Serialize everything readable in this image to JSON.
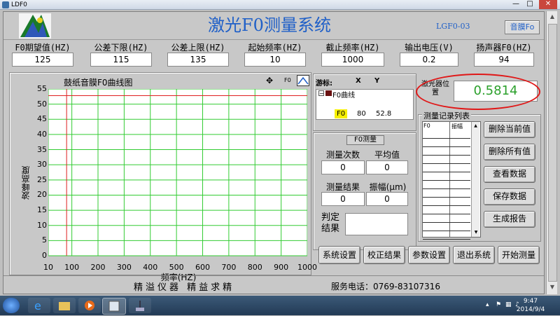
{
  "window": {
    "title": "LDF0"
  },
  "header": {
    "title": "激光F0测量系统",
    "model": "LGF0-03",
    "mode_button": "音膜Fo"
  },
  "params": [
    {
      "label": "F0期望值(HZ)",
      "value": "125"
    },
    {
      "label": "公差下限(HZ)",
      "value": "115"
    },
    {
      "label": "公差上限(HZ)",
      "value": "135"
    },
    {
      "label": "起始频率(HZ)",
      "value": "10"
    },
    {
      "label": "截止频率(HZ)",
      "value": "1000"
    },
    {
      "label": "输出电压(V)",
      "value": "0.2"
    },
    {
      "label": "扬声器F0(HZ)",
      "value": "94"
    }
  ],
  "chart": {
    "legend_label": "F0"
  },
  "chart_data": {
    "type": "line",
    "title": "鼓纸音膜F0曲线图",
    "xlabel": "频率(HZ)",
    "ylabel": "波峰高度",
    "xlim": [
      10,
      1000
    ],
    "ylim": [
      0,
      55
    ],
    "x_ticks": [
      "10",
      "100",
      "200",
      "300",
      "400",
      "500",
      "600",
      "700",
      "800",
      "900",
      "1000"
    ],
    "y_ticks": [
      "0",
      "5",
      "10",
      "15",
      "20",
      "25",
      "30",
      "35",
      "40",
      "45",
      "50",
      "55"
    ],
    "grid": true,
    "cursor": {
      "x": 80,
      "y": 52.8
    },
    "series": []
  },
  "cursor_panel": {
    "title": "游标:",
    "col_x": "X",
    "col_y": "Y",
    "tree_label": "F0曲线",
    "row_name": "F0",
    "x": "80",
    "y": "52.8"
  },
  "f0_measure": {
    "title": "F0测量",
    "count_label": "测量次数",
    "count_value": "0",
    "avg_label": "平均值",
    "avg_value": "0",
    "result_label": "测量结果",
    "result_value": "0",
    "amp_label": "振幅(μm)",
    "amp_value": "0",
    "judge_label": "判定结果"
  },
  "laser": {
    "label": "激光器位置",
    "value": "0.5814"
  },
  "records": {
    "title": "测量记录列表",
    "columns": [
      "F0",
      "振幅"
    ],
    "buttons": [
      "删除当前值",
      "删除所有值",
      "查看数据",
      "保存数据",
      "生成报告"
    ]
  },
  "actions": [
    "系统设置",
    "校正结果",
    "参数设置",
    "退出系统",
    "开始测量"
  ],
  "footer": {
    "slogan": "精溢仪器  精益求精",
    "phone": "服务电话：0769-83107316"
  },
  "taskbar": {
    "time": "9:47",
    "date": "2014/9/4"
  },
  "colors": {
    "grid": "#33cc33",
    "cursor": "#e02020",
    "title_blue": "#2060c8",
    "laser_value": "#2ba02b",
    "highlight_ellipse": "#e01818"
  }
}
